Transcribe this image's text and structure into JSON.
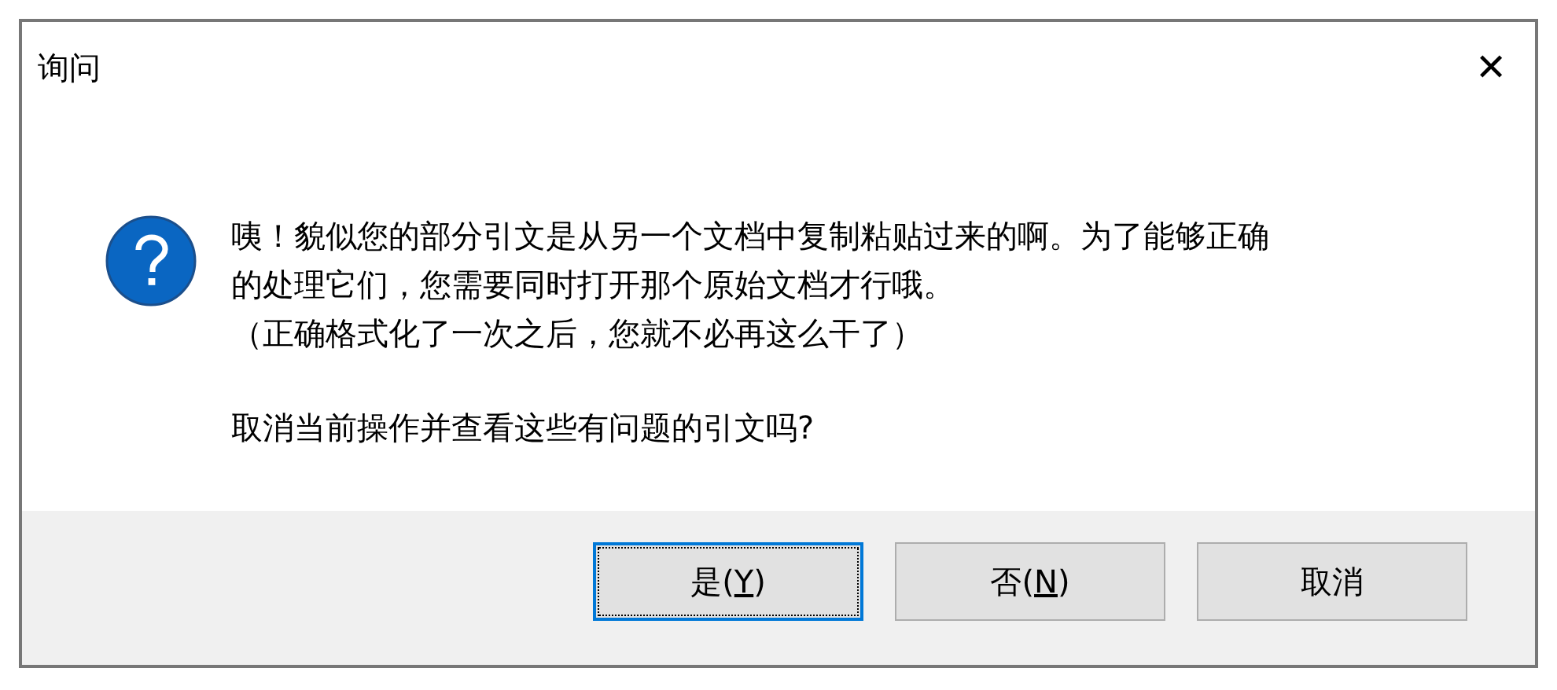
{
  "window": {
    "title": "询问",
    "close": "✕"
  },
  "message": {
    "lines": [
      "咦！貌似您的部分引文是从另一个文档中复制粘贴过来的啊。为了能够正确",
      "的处理它们，您需要同时打开那个原始文档才行哦。",
      "（正确格式化了一次之后，您就不必再这么干了）"
    ],
    "question": "取消当前操作并查看这些有问题的引文吗?"
  },
  "buttons": [
    {
      "before": "是(",
      "mnemonic": "Y",
      "after": ")",
      "focused": true
    },
    {
      "before": "否(",
      "mnemonic": "N",
      "after": ")",
      "focused": false
    },
    {
      "before": "取消",
      "focused": false
    }
  ]
}
